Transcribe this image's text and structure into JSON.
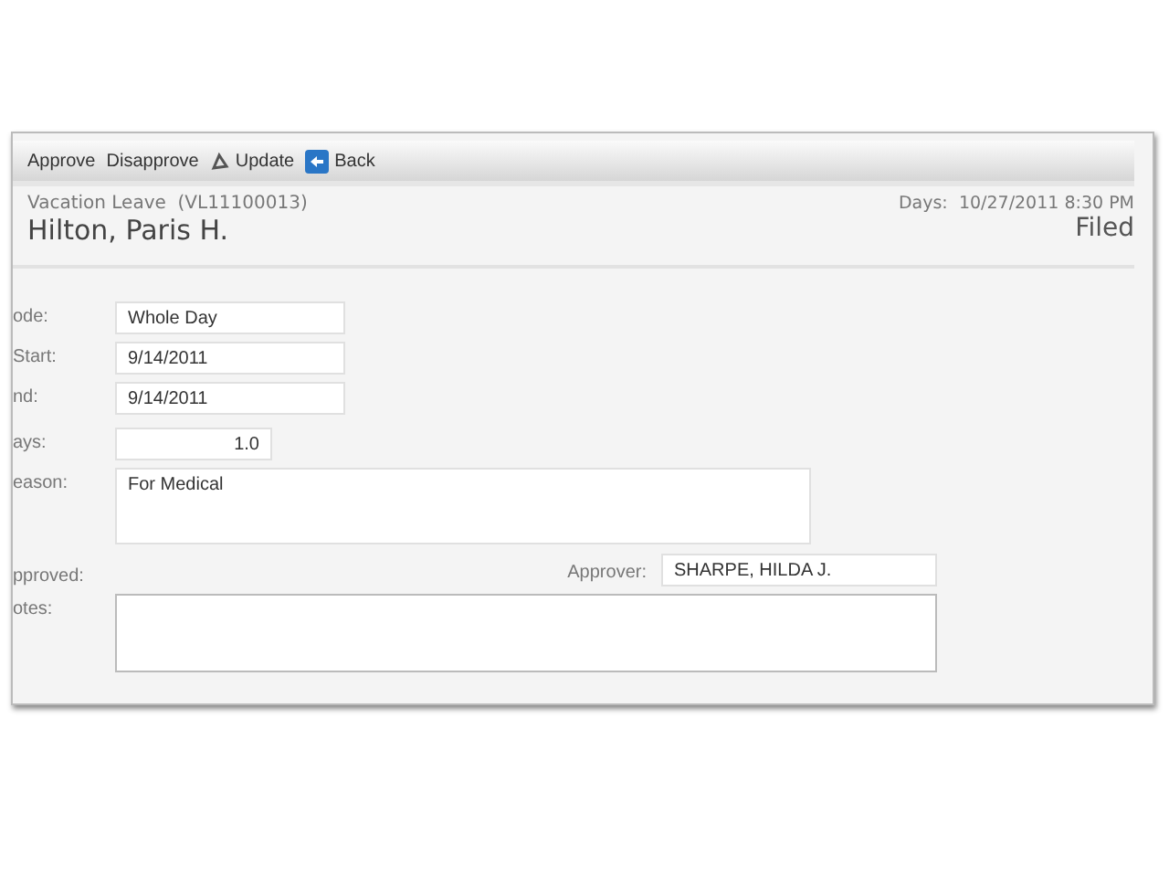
{
  "toolbar": [
    {
      "label": "Approve",
      "kind": "text"
    },
    {
      "label": "Disapprove",
      "kind": "text"
    },
    {
      "label": "Update",
      "kind": "update"
    },
    {
      "label": "Back",
      "kind": "back"
    }
  ],
  "header": {
    "subtitle": "Vacation Leave  (VL11100013)",
    "name": "Hilton, Paris H.",
    "date_label": "Days:",
    "date": "10/27/2011 8:30 PM",
    "status": "Filed"
  },
  "form": {
    "mode": {
      "label": "ode:",
      "value": "Whole Day"
    },
    "start": {
      "label": "Start:",
      "value": "9/14/2011"
    },
    "end": {
      "label": "nd:",
      "value": "9/14/2011"
    },
    "days": {
      "label": "ays:",
      "value": "1.0"
    },
    "reason": {
      "label": "eason:",
      "value": "For Medical"
    },
    "approved": {
      "label": "pproved:"
    },
    "approver": {
      "label": "Approver:",
      "value": "SHARPE, HILDA J."
    },
    "notes": {
      "label": "otes:"
    }
  }
}
